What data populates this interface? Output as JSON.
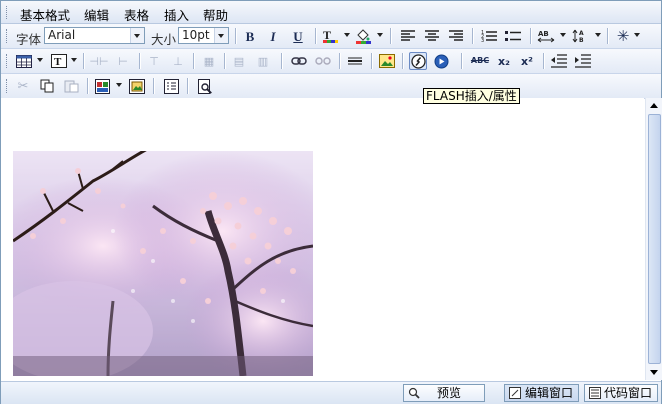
{
  "menu": [
    "基本格式",
    "编辑",
    "表格",
    "插入",
    "帮助"
  ],
  "toolbar1": {
    "font_label": "字体",
    "font_value": "Arial",
    "size_label": "大小",
    "size_value": "10pt",
    "bold": "B",
    "italic": "I",
    "underline": "U",
    "spell_label": "ABC",
    "subscript": "x₂",
    "superscript": "x²"
  },
  "tooltip": "FLASH插入/属性",
  "status": {
    "preview": "预览",
    "edit_window": "编辑窗口",
    "code_window": "代码窗口"
  },
  "colors": {
    "accent": "#7f9db9",
    "active": "#dce7f8",
    "tooltip_bg": "#ffffe1"
  }
}
